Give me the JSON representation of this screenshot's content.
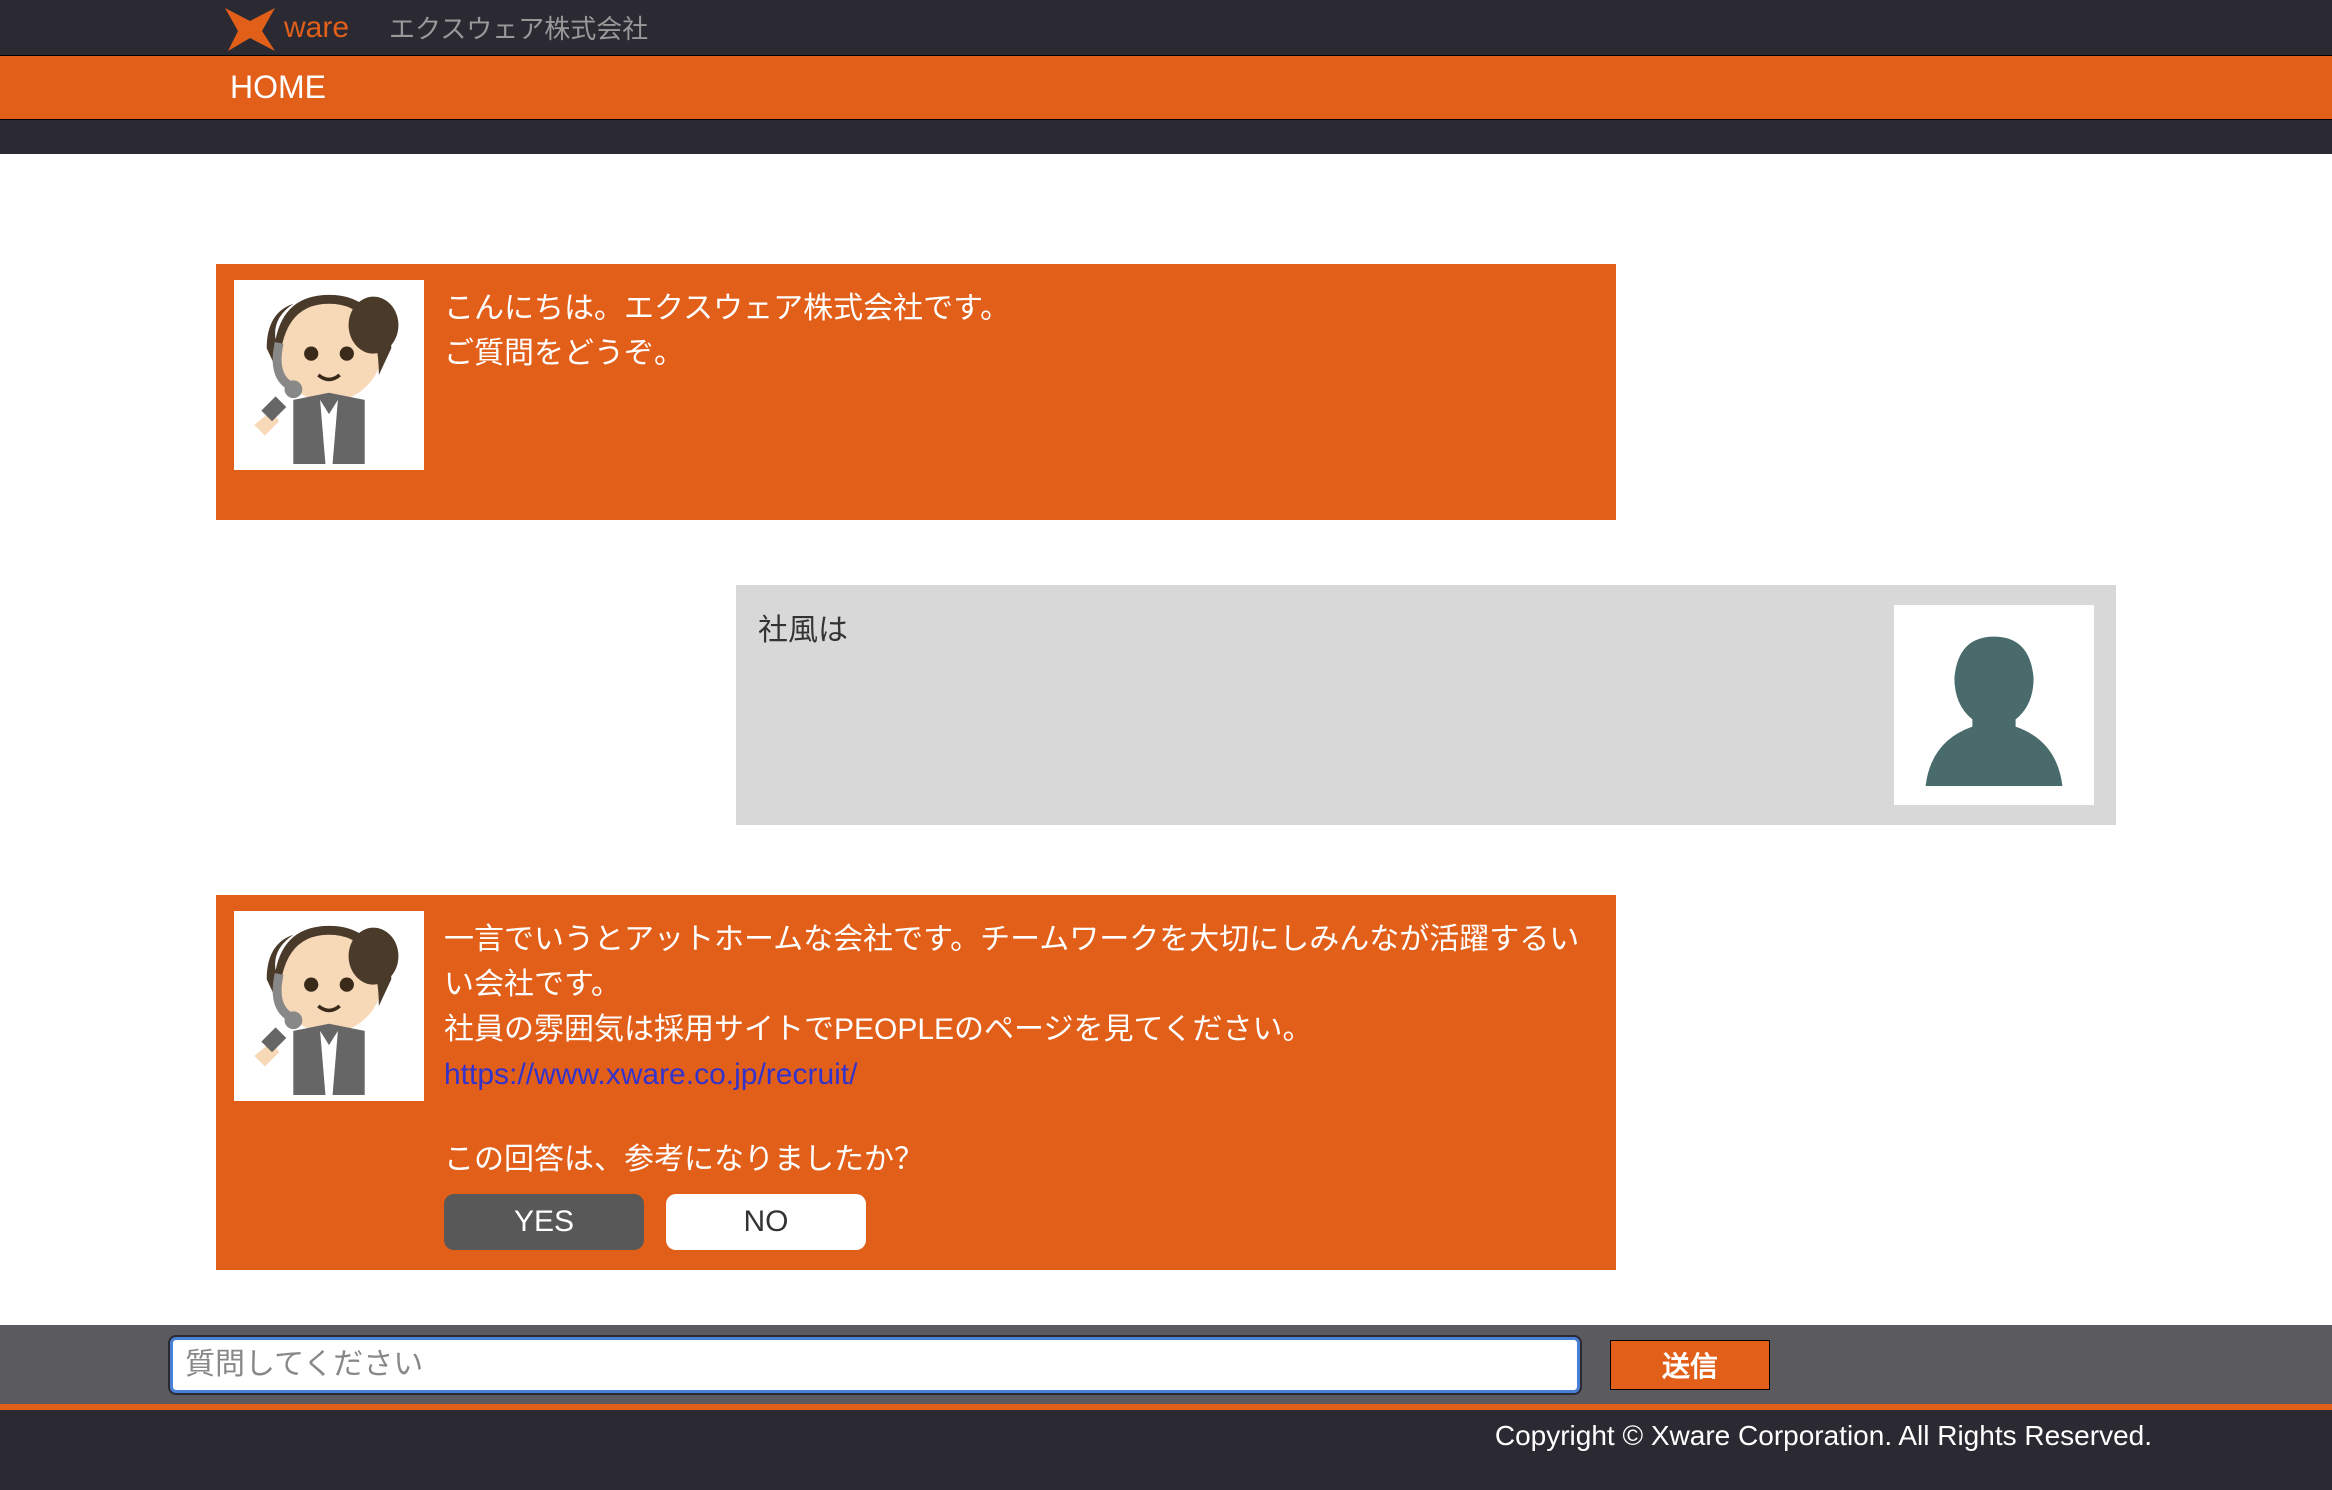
{
  "header": {
    "logo_text": "ware",
    "company_name": "エクスウェア株式会社"
  },
  "nav": {
    "home": "HOME"
  },
  "chat": {
    "bot1": {
      "line1": "こんにちは。エクスウェア株式会社です。",
      "line2": "ご質問をどうぞ。"
    },
    "user1": {
      "text": "社風は"
    },
    "bot2": {
      "line1": "一言でいうとアットホームな会社です。チームワークを大切にしみんなが活躍するいい会社です。",
      "line2": "社員の雰囲気は採用サイトでPEOPLEのページを見てください。",
      "link_text": "https://www.xware.co.jp/recruit/",
      "feedback_q": "この回答は、参考になりましたか？",
      "yes": "YES",
      "no": "NO"
    }
  },
  "input": {
    "placeholder": "質問してください",
    "send": "送信"
  },
  "footer": {
    "copyright": "Copyright © Xware Corporation. All Rights Reserved."
  }
}
